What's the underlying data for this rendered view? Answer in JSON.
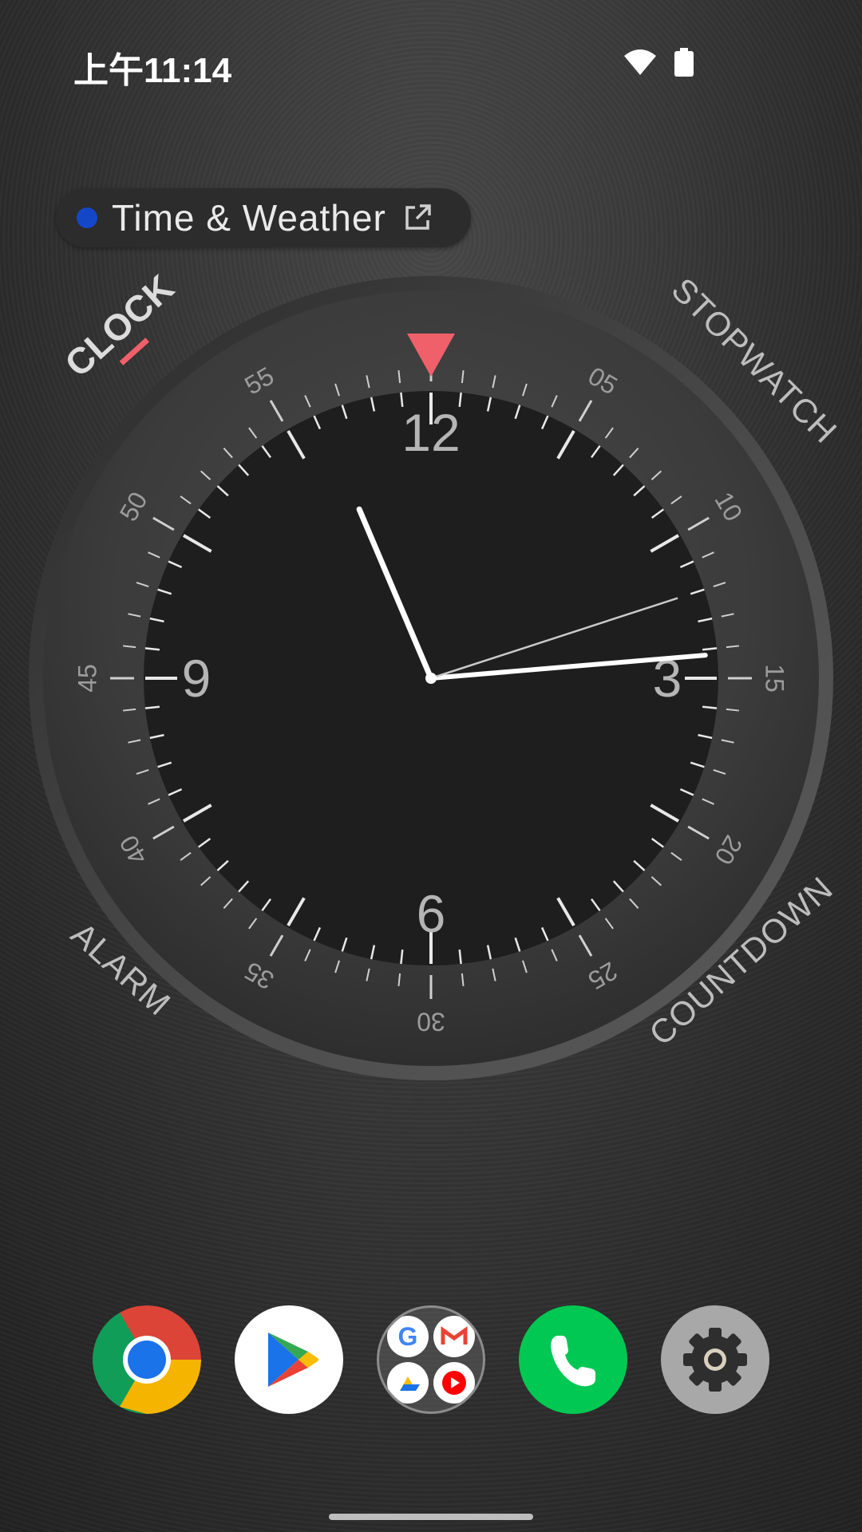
{
  "status_bar": {
    "time": "上午11:14",
    "icons": [
      "wifi-icon",
      "battery-icon"
    ]
  },
  "widget_chip": {
    "label": "Time & Weather",
    "dot_color": "#1447c8",
    "icon": "external-link-icon"
  },
  "clock": {
    "mode_labels": {
      "clock": "CLOCK",
      "stopwatch": "STOPWATCH",
      "alarm": "ALARM",
      "countdown": "COUNTDOWN"
    },
    "active_mode": "clock",
    "hour_numerals": {
      "h12": "12",
      "h3": "3",
      "h6": "6",
      "h9": "9"
    },
    "minute_labels": [
      "05",
      "10",
      "15",
      "20",
      "25",
      "30",
      "35",
      "40",
      "45",
      "50",
      "55"
    ],
    "time": {
      "hours": 11,
      "minutes": 14,
      "seconds": 12
    },
    "accent_color": "#f0606a"
  },
  "dock": {
    "apps": [
      {
        "name": "Chrome",
        "icon": "chrome-icon"
      },
      {
        "name": "Play Store",
        "icon": "play-store-icon"
      },
      {
        "name": "Google apps folder",
        "icon": "folder-icon"
      },
      {
        "name": "Phone",
        "icon": "phone-icon"
      },
      {
        "name": "Settings",
        "icon": "settings-icon"
      }
    ]
  }
}
